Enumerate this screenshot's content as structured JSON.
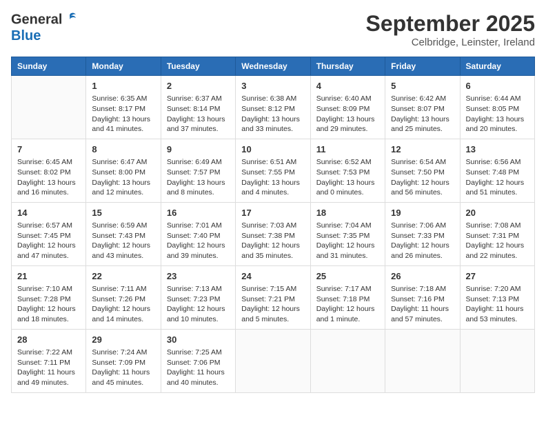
{
  "header": {
    "logo_general": "General",
    "logo_blue": "Blue",
    "month_title": "September 2025",
    "location": "Celbridge, Leinster, Ireland"
  },
  "columns": [
    "Sunday",
    "Monday",
    "Tuesday",
    "Wednesday",
    "Thursday",
    "Friday",
    "Saturday"
  ],
  "weeks": [
    [
      {
        "day": "",
        "info": ""
      },
      {
        "day": "1",
        "info": "Sunrise: 6:35 AM\nSunset: 8:17 PM\nDaylight: 13 hours\nand 41 minutes."
      },
      {
        "day": "2",
        "info": "Sunrise: 6:37 AM\nSunset: 8:14 PM\nDaylight: 13 hours\nand 37 minutes."
      },
      {
        "day": "3",
        "info": "Sunrise: 6:38 AM\nSunset: 8:12 PM\nDaylight: 13 hours\nand 33 minutes."
      },
      {
        "day": "4",
        "info": "Sunrise: 6:40 AM\nSunset: 8:09 PM\nDaylight: 13 hours\nand 29 minutes."
      },
      {
        "day": "5",
        "info": "Sunrise: 6:42 AM\nSunset: 8:07 PM\nDaylight: 13 hours\nand 25 minutes."
      },
      {
        "day": "6",
        "info": "Sunrise: 6:44 AM\nSunset: 8:05 PM\nDaylight: 13 hours\nand 20 minutes."
      }
    ],
    [
      {
        "day": "7",
        "info": "Sunrise: 6:45 AM\nSunset: 8:02 PM\nDaylight: 13 hours\nand 16 minutes."
      },
      {
        "day": "8",
        "info": "Sunrise: 6:47 AM\nSunset: 8:00 PM\nDaylight: 13 hours\nand 12 minutes."
      },
      {
        "day": "9",
        "info": "Sunrise: 6:49 AM\nSunset: 7:57 PM\nDaylight: 13 hours\nand 8 minutes."
      },
      {
        "day": "10",
        "info": "Sunrise: 6:51 AM\nSunset: 7:55 PM\nDaylight: 13 hours\nand 4 minutes."
      },
      {
        "day": "11",
        "info": "Sunrise: 6:52 AM\nSunset: 7:53 PM\nDaylight: 13 hours\nand 0 minutes."
      },
      {
        "day": "12",
        "info": "Sunrise: 6:54 AM\nSunset: 7:50 PM\nDaylight: 12 hours\nand 56 minutes."
      },
      {
        "day": "13",
        "info": "Sunrise: 6:56 AM\nSunset: 7:48 PM\nDaylight: 12 hours\nand 51 minutes."
      }
    ],
    [
      {
        "day": "14",
        "info": "Sunrise: 6:57 AM\nSunset: 7:45 PM\nDaylight: 12 hours\nand 47 minutes."
      },
      {
        "day": "15",
        "info": "Sunrise: 6:59 AM\nSunset: 7:43 PM\nDaylight: 12 hours\nand 43 minutes."
      },
      {
        "day": "16",
        "info": "Sunrise: 7:01 AM\nSunset: 7:40 PM\nDaylight: 12 hours\nand 39 minutes."
      },
      {
        "day": "17",
        "info": "Sunrise: 7:03 AM\nSunset: 7:38 PM\nDaylight: 12 hours\nand 35 minutes."
      },
      {
        "day": "18",
        "info": "Sunrise: 7:04 AM\nSunset: 7:35 PM\nDaylight: 12 hours\nand 31 minutes."
      },
      {
        "day": "19",
        "info": "Sunrise: 7:06 AM\nSunset: 7:33 PM\nDaylight: 12 hours\nand 26 minutes."
      },
      {
        "day": "20",
        "info": "Sunrise: 7:08 AM\nSunset: 7:31 PM\nDaylight: 12 hours\nand 22 minutes."
      }
    ],
    [
      {
        "day": "21",
        "info": "Sunrise: 7:10 AM\nSunset: 7:28 PM\nDaylight: 12 hours\nand 18 minutes."
      },
      {
        "day": "22",
        "info": "Sunrise: 7:11 AM\nSunset: 7:26 PM\nDaylight: 12 hours\nand 14 minutes."
      },
      {
        "day": "23",
        "info": "Sunrise: 7:13 AM\nSunset: 7:23 PM\nDaylight: 12 hours\nand 10 minutes."
      },
      {
        "day": "24",
        "info": "Sunrise: 7:15 AM\nSunset: 7:21 PM\nDaylight: 12 hours\nand 5 minutes."
      },
      {
        "day": "25",
        "info": "Sunrise: 7:17 AM\nSunset: 7:18 PM\nDaylight: 12 hours\nand 1 minute."
      },
      {
        "day": "26",
        "info": "Sunrise: 7:18 AM\nSunset: 7:16 PM\nDaylight: 11 hours\nand 57 minutes."
      },
      {
        "day": "27",
        "info": "Sunrise: 7:20 AM\nSunset: 7:13 PM\nDaylight: 11 hours\nand 53 minutes."
      }
    ],
    [
      {
        "day": "28",
        "info": "Sunrise: 7:22 AM\nSunset: 7:11 PM\nDaylight: 11 hours\nand 49 minutes."
      },
      {
        "day": "29",
        "info": "Sunrise: 7:24 AM\nSunset: 7:09 PM\nDaylight: 11 hours\nand 45 minutes."
      },
      {
        "day": "30",
        "info": "Sunrise: 7:25 AM\nSunset: 7:06 PM\nDaylight: 11 hours\nand 40 minutes."
      },
      {
        "day": "",
        "info": ""
      },
      {
        "day": "",
        "info": ""
      },
      {
        "day": "",
        "info": ""
      },
      {
        "day": "",
        "info": ""
      }
    ]
  ]
}
